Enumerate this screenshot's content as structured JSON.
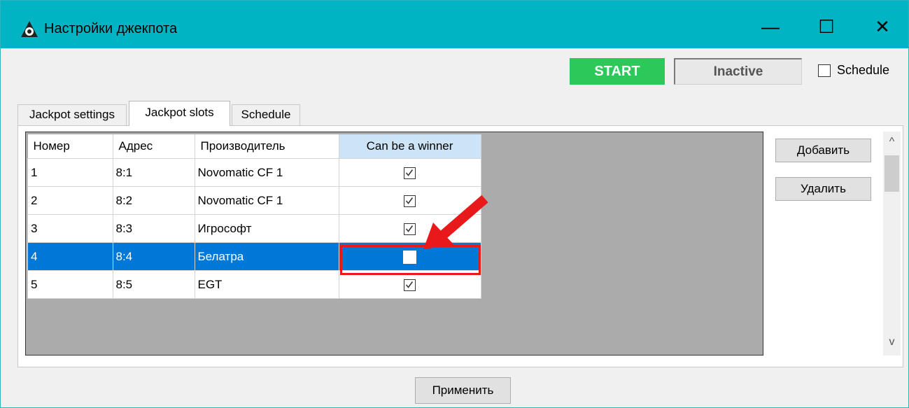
{
  "window": {
    "title": "Настройки джекпота",
    "minimize": "—",
    "maximize": "☐",
    "close": "✕"
  },
  "toolbar": {
    "start_label": "START",
    "status_text": "Inactive",
    "schedule_label": "Schedule",
    "schedule_checked": false
  },
  "tabs": [
    {
      "label": "Jackpot settings"
    },
    {
      "label": "Jackpot slots",
      "active": true
    },
    {
      "label": "Schedule"
    }
  ],
  "grid": {
    "columns": [
      "Номер",
      "Адрес",
      "Производитель",
      "Can be a winner"
    ],
    "rows": [
      {
        "number": "1",
        "address": "8:1",
        "maker": "Novomatic CF 1",
        "winner": true
      },
      {
        "number": "2",
        "address": "8:2",
        "maker": "Novomatic CF 1",
        "winner": true
      },
      {
        "number": "3",
        "address": "8:3",
        "maker": "Игрософт",
        "winner": true
      },
      {
        "number": "4",
        "address": "8:4",
        "maker": "Белатра",
        "winner": false,
        "selected": true
      },
      {
        "number": "5",
        "address": "8:5",
        "maker": "EGT",
        "winner": true
      }
    ]
  },
  "side_buttons": {
    "add_label": "Добавить",
    "delete_label": "Удалить"
  },
  "scrollbar": {
    "up": "^",
    "down": "v"
  },
  "footer": {
    "apply_label": "Применить"
  },
  "colors": {
    "titlebar": "#00b4c3",
    "start": "#2cc85a",
    "selection": "#0078d7",
    "highlight": "#e8191b"
  }
}
